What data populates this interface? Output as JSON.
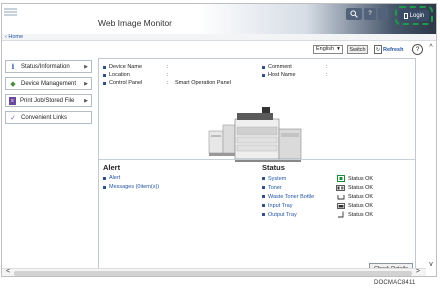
{
  "header": {
    "title": "Web Image Monitor",
    "search_icon": "search-icon",
    "help_label": "?",
    "login_label": "Login"
  },
  "nav": {
    "home_label": "Home"
  },
  "toolbar": {
    "language_value": "English",
    "switch_label": "Switch",
    "refresh_label": "Refresh",
    "help_label": "?"
  },
  "sidebar": {
    "items": [
      {
        "label": "Status/Information",
        "icon": "info-icon"
      },
      {
        "label": "Device Management",
        "icon": "device-management-icon"
      },
      {
        "label": "Print Job/Stored File",
        "icon": "print-job-icon"
      },
      {
        "label": "Convenient Links",
        "icon": "links-icon"
      }
    ]
  },
  "device_info": {
    "left": [
      {
        "label": "Device Name",
        "sep": ":",
        "value": ""
      },
      {
        "label": "Location",
        "sep": ":",
        "value": ""
      },
      {
        "label": "Control Panel",
        "sep": ":",
        "value": "Smart Operation Panel"
      }
    ],
    "right": [
      {
        "label": "Comment",
        "sep": ":",
        "value": ""
      },
      {
        "label": "Host Name",
        "sep": ":",
        "value": ""
      }
    ]
  },
  "alert": {
    "title": "Alert",
    "links": [
      "Alert",
      "Messages (0item(s))"
    ]
  },
  "status": {
    "title": "Status",
    "rows": [
      {
        "name": "System",
        "value": "Status OK",
        "icon": "system-ok-icon"
      },
      {
        "name": "Toner",
        "value": "Status OK",
        "icon": "toner-icon"
      },
      {
        "name": "Waste Toner Bottle",
        "value": "Status OK",
        "icon": "waste-toner-icon"
      },
      {
        "name": "Input Tray",
        "value": "Status OK",
        "icon": "input-tray-icon"
      },
      {
        "name": "Output Tray",
        "value": "Status OK",
        "icon": "output-tray-icon"
      }
    ],
    "check_details_label": "Check Details"
  },
  "figure_code": "DOCMAC8411",
  "colors": {
    "link": "#2456a4",
    "highlight_border": "#1d9a4c",
    "header_dark": "#2c3848"
  }
}
